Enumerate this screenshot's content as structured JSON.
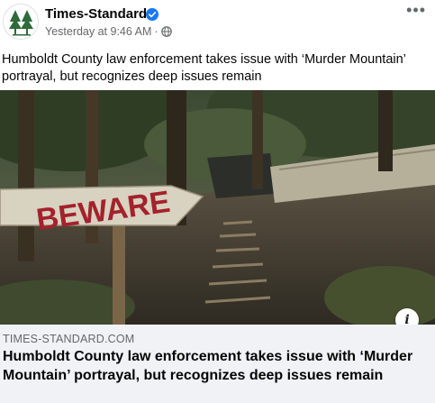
{
  "header": {
    "page_name": "Times-Standard",
    "timestamp": "Yesterday at 9:46 AM",
    "separator": "·",
    "verified": true,
    "icons": {
      "avatar": "redwood-tree-logo",
      "verified": "verified-badge-icon",
      "audience": "globe-icon",
      "menu": "more-options-icon"
    },
    "menu_label": "•••"
  },
  "post": {
    "text": "Humboldt County law enforcement takes issue with ‘Murder Mountain’ portrayal, but recognizes deep issues remain"
  },
  "link_preview": {
    "image_sign_text": "BEWARE",
    "info_label": "i",
    "domain": "TIMES-STANDARD.COM",
    "title": "Humboldt County law enforcement takes issue with ‘Murder Mountain’ portrayal, but recognizes deep issues remain"
  },
  "colors": {
    "brand_green": "#2e6b3a",
    "verified_blue": "#1877f2",
    "footer_bg": "#f0f2f5",
    "secondary_text": "#65676b",
    "sign_paint": "#a3222b"
  }
}
